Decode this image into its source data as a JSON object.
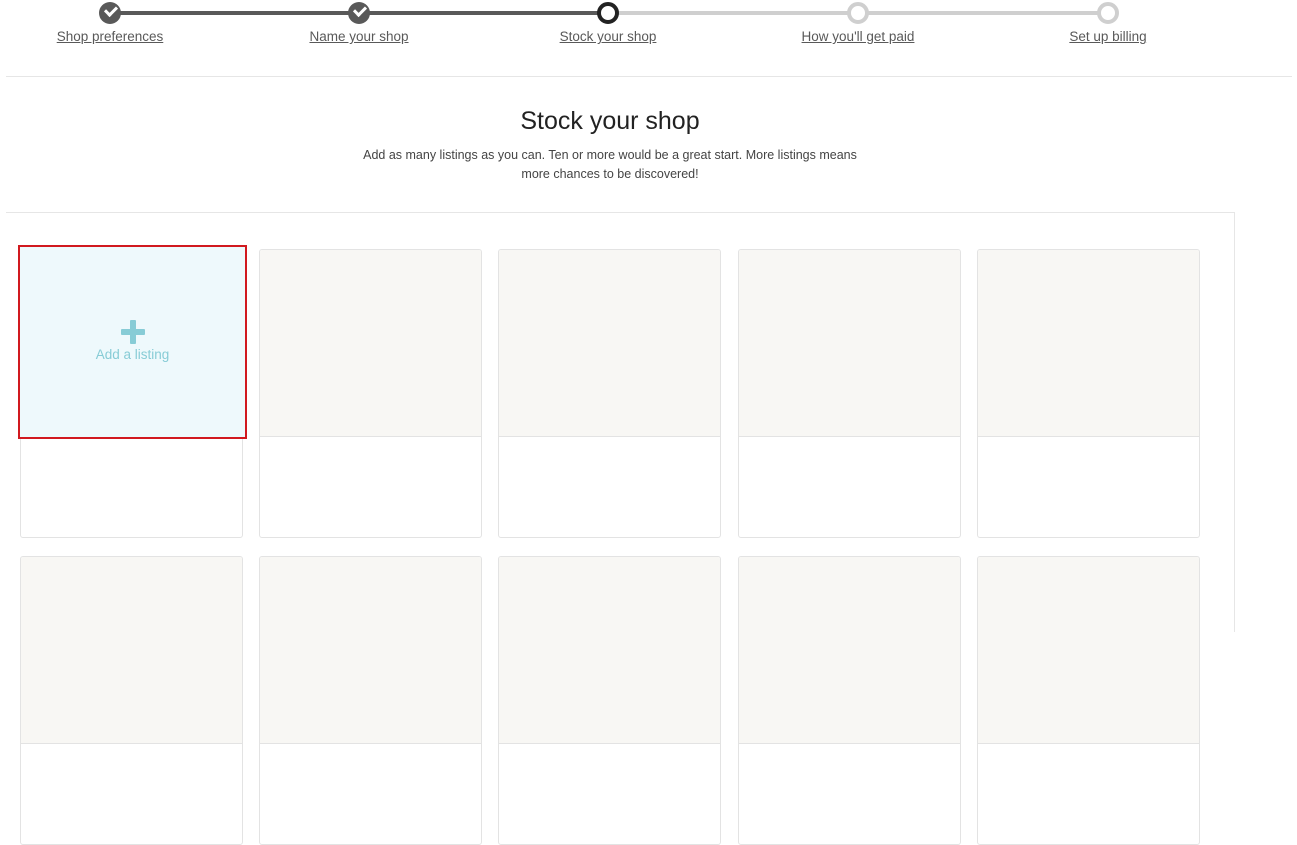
{
  "stepper": {
    "steps": [
      {
        "label": "Shop preferences",
        "status": "complete"
      },
      {
        "label": "Name your shop",
        "status": "complete"
      },
      {
        "label": "Stock your shop",
        "status": "current"
      },
      {
        "label": "How you'll get paid",
        "status": "pending"
      },
      {
        "label": "Set up billing",
        "status": "pending"
      }
    ]
  },
  "header": {
    "title": "Stock your shop",
    "subtitle_line1": "Add as many listings as you can. Ten or more would be a great start. More listings means",
    "subtitle_line2": "more chances to be discovered!"
  },
  "listings": {
    "add_label": "Add a listing",
    "add_icon": "plus-icon"
  },
  "colors": {
    "step_complete": "#595959",
    "step_pending": "#cfcfcf",
    "add_accent": "#87ccd6",
    "add_background": "#eef9fc",
    "highlight_border": "#d1191f",
    "placeholder_fill": "#f8f7f4"
  }
}
